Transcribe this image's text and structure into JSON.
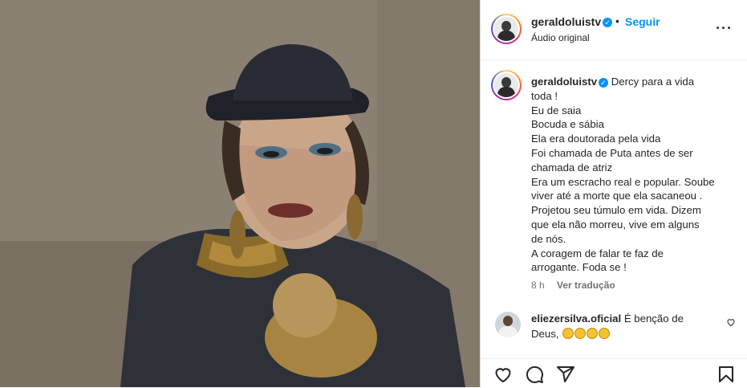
{
  "post": {
    "username": "geraldoluistv",
    "verified_icon": "verified-badge-icon",
    "follow_label": "Seguir",
    "separator": "•",
    "audio_label": "Áudio original",
    "more_icon": "more-options-icon"
  },
  "caption": {
    "username": "geraldoluistv",
    "lines": [
      "Dercy para a vida",
      "toda !",
      "Eu de saia",
      "Bocuda e sábia",
      "Ela era doutorada pela vida",
      "Foi chamada de Puta antes de ser",
      "chamada de atriz",
      "Era um escracho real e popular. Soube",
      "viver até a morte que ela sacaneou .",
      "Projetou seu túmulo em vida. Dizem",
      "que ela não morreu, vive em alguns",
      "de nós.",
      "A coragem de falar te faz de",
      "arrogante. Foda se !"
    ],
    "time": "8 h",
    "translate_label": "Ver tradução"
  },
  "comment": {
    "username": "eliezersilva.oficial",
    "text_line1": "É benção de",
    "text_line2": "Deus,",
    "emoji_icon": "clapping-hands-icon",
    "like_icon": "heart-icon"
  },
  "actions": {
    "like_icon": "heart-icon",
    "comment_icon": "comment-icon",
    "share_icon": "share-icon",
    "save_icon": "bookmark-icon"
  },
  "colors": {
    "link_blue": "#0095f6",
    "text": "#262626",
    "muted": "#737373"
  }
}
